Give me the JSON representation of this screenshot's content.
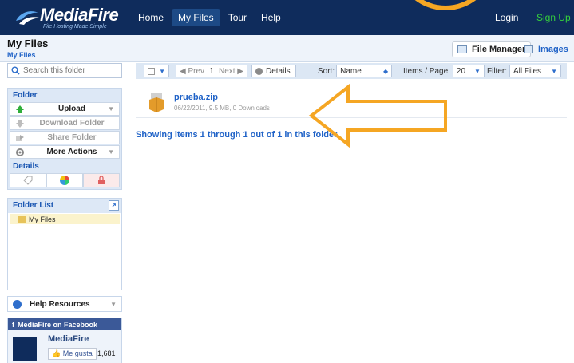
{
  "brand": {
    "name": "MediaFire",
    "tagline": "File Hosting Made Simple"
  },
  "nav": {
    "items": [
      "Home",
      "My Files",
      "Tour",
      "Help"
    ],
    "active": "My Files",
    "login": "Login",
    "signup": "Sign Up"
  },
  "header": {
    "title": "My Files",
    "breadcrumb": "My Files",
    "file_manager": "File Manager",
    "images": "Images"
  },
  "toolbar": {
    "search_placeholder": "Search this folder",
    "prev": "Prev",
    "page": "1",
    "next": "Next",
    "details": "Details",
    "sort_label": "Sort:",
    "sort_value": "Name",
    "items_label": "Items / Page:",
    "items_value": "20",
    "filter_label": "Filter:",
    "filter_value": "All Files"
  },
  "sidebar": {
    "folder_heading": "Folder",
    "actions": {
      "upload": "Upload",
      "download": "Download Folder",
      "share": "Share Folder",
      "more": "More Actions"
    },
    "details_heading": "Details",
    "folder_list_heading": "Folder List",
    "folders": [
      "My Files"
    ],
    "help": "Help Resources",
    "facebook": {
      "heading": "MediaFire on Facebook",
      "page_name": "MediaFire",
      "like_label": "Me gusta",
      "like_count": "1,681"
    }
  },
  "files": [
    {
      "name": "prueba.zip",
      "meta": "06/22/2011, 9.5 MB, 0 Downloads"
    }
  ],
  "status": "Showing items 1 through 1 out of 1 in this folder",
  "colors": {
    "topbar": "#0f2c5c",
    "link": "#1f62c7",
    "annotation": "#f5a623",
    "signup": "#35d13c"
  }
}
